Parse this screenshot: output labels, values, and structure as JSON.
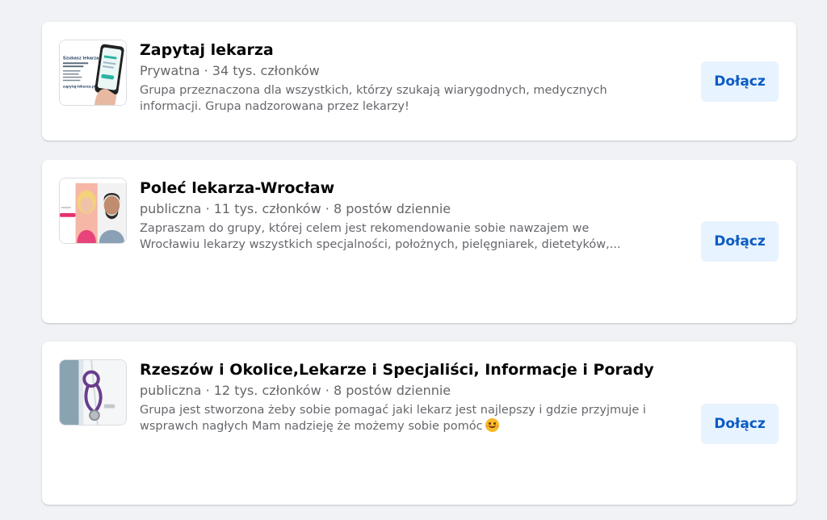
{
  "groups": [
    {
      "title": "Zapytaj lekarza",
      "meta": "Prywatna · 34 tys. członków",
      "description_lines": [
        "Grupa przeznaczona dla wszystkich, którzy szukają wiarygodnych, medycznych",
        "informacji. Grupa nadzorowana przez lekarzy!"
      ],
      "join_label": "Dołącz",
      "thumbnail": {
        "headline": "Szukasz lekarza?",
        "url": "zapytaj-lekarza.pl"
      }
    },
    {
      "title": "Poleć lekarza-Wrocław",
      "meta": "publiczna · 11 tys. członków · 8 postów dziennie",
      "description_lines": [
        "Zapraszam do grupy, której celem jest rekomendowanie sobie nawzajem we",
        "Wrocławiu lekarzy wszystkich specjalności, położnych, pielęgniarek, dietetyków,..."
      ],
      "join_label": "Dołącz"
    },
    {
      "title": "Rzeszów i Okolice,Lekarze i Specjaliści, Informacje i Porady",
      "meta": "publiczna · 12 tys. członków · 8 postów dziennie",
      "description_lines": [
        "Grupa jest stworzona żeby sobie pomagać jaki lekarz jest najlepszy i gdzie przyjmuje i",
        "wsprawch nagłych Mam nadzieję że możemy sobie pomóc"
      ],
      "join_label": "Dołącz",
      "emoji": "smiling-face-icon"
    }
  ],
  "colors": {
    "page_background": "#f0f2f5",
    "card_background": "#ffffff",
    "button_background": "#e7f3ff",
    "button_text": "#0a5bc4",
    "secondary_text": "#65676b"
  }
}
